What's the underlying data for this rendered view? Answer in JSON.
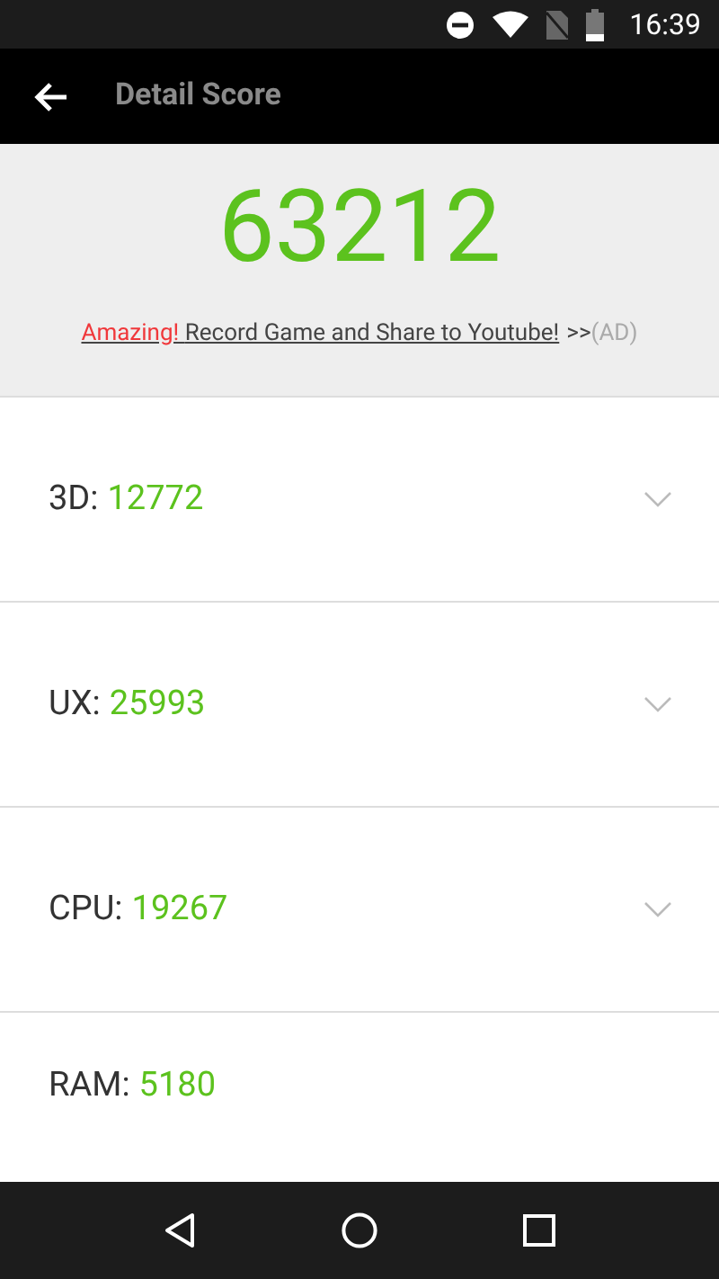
{
  "status_bar": {
    "time": "16:39"
  },
  "app_bar": {
    "title": "Detail Score"
  },
  "total": {
    "score": "63212",
    "ad": {
      "highlight": "Amazing! ",
      "link": "Record Game and Share to Youtube!",
      "arrows": ">>",
      "tag": "(AD)"
    }
  },
  "rows": [
    {
      "label": "3D:",
      "score": "12772",
      "expandable": true
    },
    {
      "label": "UX:",
      "score": "25993",
      "expandable": true
    },
    {
      "label": "CPU:",
      "score": "19267",
      "expandable": true
    },
    {
      "label": "RAM:",
      "score": "5180",
      "expandable": false
    }
  ]
}
